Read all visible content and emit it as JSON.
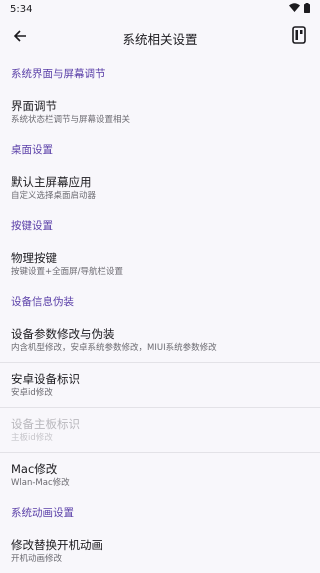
{
  "status_bar": {
    "time": "5:34"
  },
  "app_bar": {
    "title": "系统相关设置"
  },
  "sections": [
    {
      "header": "系统界面与屏幕调节",
      "items": [
        {
          "title": "界面调节",
          "subtitle": "系统状态栏调节与屏幕设置相关",
          "disabled": false
        }
      ]
    },
    {
      "header": "桌面设置",
      "items": [
        {
          "title": "默认主屏幕应用",
          "subtitle": "自定义选择桌面启动器",
          "disabled": false
        }
      ]
    },
    {
      "header": "按键设置",
      "items": [
        {
          "title": "物理按键",
          "subtitle": "按键设置+全面屏/导航栏设置",
          "disabled": false
        }
      ]
    },
    {
      "header": "设备信息伪装",
      "items": [
        {
          "title": "设备参数修改与伪装",
          "subtitle": "内含机型修改，安卓系统参数修改，MIUI系统参数修改",
          "disabled": false
        },
        {
          "title": "安卓设备标识",
          "subtitle": "安卓id修改",
          "disabled": false
        },
        {
          "title": "设备主板标识",
          "subtitle": "主板id修改",
          "disabled": true
        },
        {
          "title": "Mac修改",
          "subtitle": "Wlan-Mac修改",
          "disabled": false
        }
      ]
    },
    {
      "header": "系统动画设置",
      "items": [
        {
          "title": "修改替换开机动画",
          "subtitle": "开机动画修改",
          "disabled": false
        }
      ]
    }
  ],
  "colors": {
    "accent": "#5a3fa8",
    "background": "#f8f7fb",
    "divider": "#e3e2e7"
  },
  "icons": {
    "back": "arrow-left-icon",
    "action": "device-panel-icon",
    "wifi": "wifi-icon",
    "battery": "battery-icon"
  }
}
